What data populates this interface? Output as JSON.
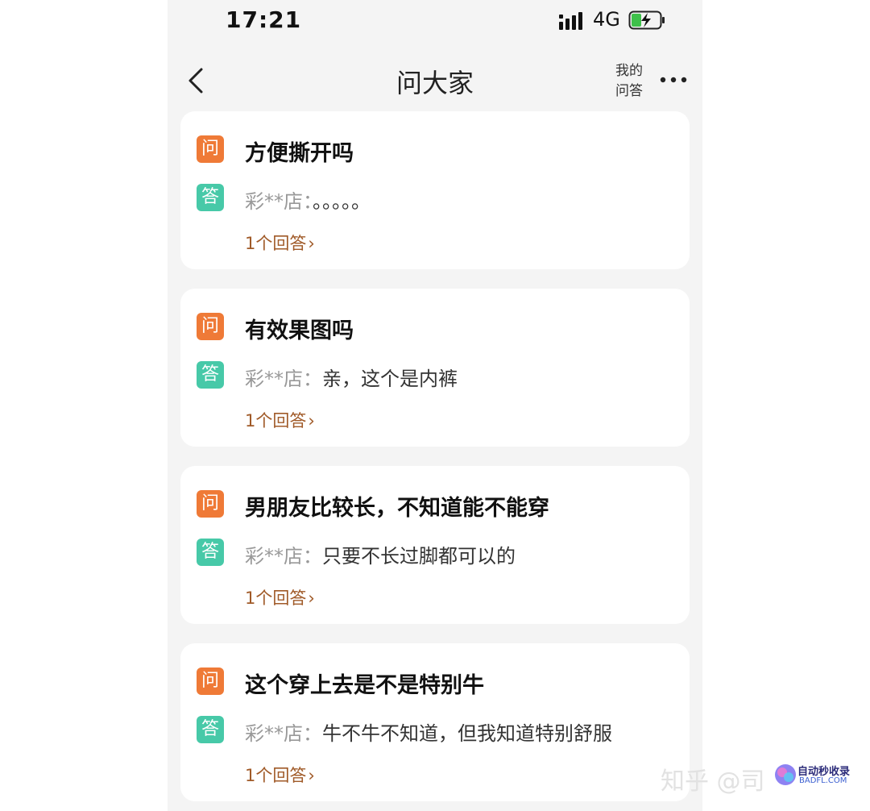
{
  "status_bar": {
    "time": "17:21",
    "network": "4G",
    "icons": [
      "signal-icon",
      "battery-charging-icon"
    ]
  },
  "nav": {
    "title": "问大家",
    "my_qa_line1": "我的",
    "my_qa_line2": "问答",
    "icons": [
      "back-icon",
      "more-icon"
    ]
  },
  "badges": {
    "question": "问",
    "answer": "答"
  },
  "questions": [
    {
      "question": "方便撕开吗",
      "answerer": "彩**店：",
      "answer": "。。。。。",
      "answer_count": "1个回答"
    },
    {
      "question": "有效果图吗",
      "answerer": "彩**店：",
      "answer": "亲，这个是内裤",
      "answer_count": "1个回答"
    },
    {
      "question": "男朋友比较长，不知道能不能穿",
      "answerer": "彩**店：",
      "answer": "只要不长过脚都可以的",
      "answer_count": "1个回答"
    },
    {
      "question": "这个穿上去是不是特别牛",
      "answerer": "彩**店：",
      "answer": "牛不牛不知道，但我知道特别舒服",
      "answer_count": "1个回答"
    }
  ],
  "chevron": "›",
  "watermark": {
    "text": "知乎 @司",
    "brand": "自动秒收录",
    "domain": "BADFL.COM"
  },
  "colors": {
    "question_badge": "#ef7a37",
    "answer_badge": "#47c9a8",
    "answer_count": "#a05a28",
    "page_background": "#f4f4f4"
  }
}
